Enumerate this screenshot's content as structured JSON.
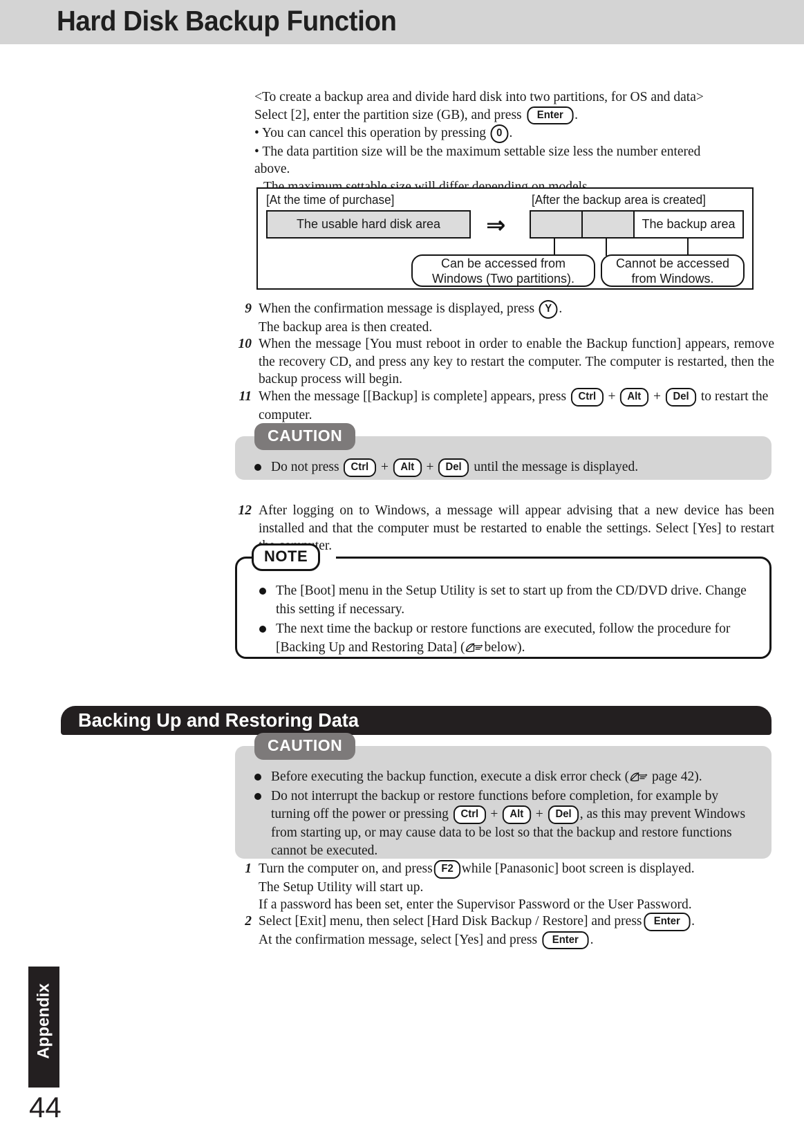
{
  "page": {
    "title": "Hard Disk Backup Function",
    "number": "44",
    "sidebar_tab": "Appendix"
  },
  "intro": {
    "line1": "<To create a backup area and divide hard disk into two partitions, for OS and data>",
    "line2_pre": "Select [2], enter the partition size (GB), and press",
    "line2_key": "Enter",
    "line2_post": ".",
    "bullet1_pre": "• You can cancel this operation by pressing",
    "bullet1_key": "0",
    "bullet1_post": ".",
    "bullet2_line1": "• The data partition size will be the maximum settable size less the number entered above.",
    "bullet2_line2": "The maximum settable size will differ depending on models."
  },
  "diagram": {
    "left_label": "[At the time of purchase]",
    "right_label": "[After the backup area is created]",
    "left_box": "The usable hard disk area",
    "arrow": "⇒",
    "right_box_backup": "The backup area",
    "callout_left": "Can be accessed from\nWindows (Two partitions).",
    "callout_left_line1": "Can be accessed from",
    "callout_left_line2": "Windows (Two partitions).",
    "callout_right_line1": "Cannot be accessed",
    "callout_right_line2": "from Windows."
  },
  "steps_upper": [
    {
      "num": "9",
      "pre": "When the confirmation message is displayed, press",
      "key1": "Y",
      "post": ".",
      "line2": "The backup area is then created."
    },
    {
      "num": "10",
      "text": "When the message [You must reboot in order to enable the Backup function] appears, remove the recovery CD, and press any key to restart the computer. The computer is restarted, then the backup process will begin."
    },
    {
      "num": "11",
      "pre": "When the message [[Backup] is complete] appears, press",
      "key1": "Ctrl",
      "plus": "+",
      "key2": "Alt",
      "key3": "Del",
      "post": "to restart the computer."
    }
  ],
  "caution_upper": {
    "tab": "CAUTION",
    "bullet_pre": "Do not press",
    "key1": "Ctrl",
    "key2": "Alt",
    "key3": "Del",
    "plus": "+",
    "bullet_post": "until the message is displayed."
  },
  "step12": {
    "num": "12",
    "text": "After logging on to Windows, a message will appear advising that a new device has been installed and that the computer must be restarted to enable the settings.  Select [Yes] to restart the computer."
  },
  "note": {
    "tab": "NOTE",
    "bullets": [
      "The [Boot] menu in the Setup Utility is set to start up from the CD/DVD drive. Change this setting if necessary.",
      "The next time the backup or restore functions are executed, follow the procedure for [Backing Up and Restoring Data] ("
    ],
    "bullet2_tail": "below)."
  },
  "section": {
    "title": "Backing Up and Restoring Data"
  },
  "caution_lower": {
    "tab": "CAUTION",
    "bullet1_pre": "Before executing the backup function, execute a disk error check (",
    "bullet1_post": "page 42).",
    "bullet2_pre": "Do not interrupt the backup or restore functions before completion, for example by turning off the power or pressing",
    "key1": "Ctrl",
    "key2": "Alt",
    "key3": "Del",
    "plus": "+",
    "bullet2_post": ", as this may prevent Windows from starting up, or may cause data to be lost so that the backup and restore functions cannot be executed."
  },
  "steps_lower": [
    {
      "num": "1",
      "pre": "Turn the computer on, and press",
      "key1": "F2",
      "post": "while [Panasonic] boot screen is displayed.",
      "line2": "The Setup Utility will start up.",
      "line3": "If a password has been set, enter the Supervisor Password or the User Password."
    },
    {
      "num": "2",
      "pre": "Select [Exit] menu, then select [Hard Disk Backup / Restore] and press",
      "key1": "Enter",
      "post": ".",
      "line2_pre": "At the confirmation message, select [Yes] and press",
      "key2": "Enter",
      "line2_post": "."
    }
  ],
  "colors": {
    "header_band": "#d4d4d4",
    "section_bar": "#231f20",
    "caution_tab": "#7d7a7a",
    "caution_body": "#d5d5d5",
    "diagram_gray": "#dcdcdc"
  }
}
